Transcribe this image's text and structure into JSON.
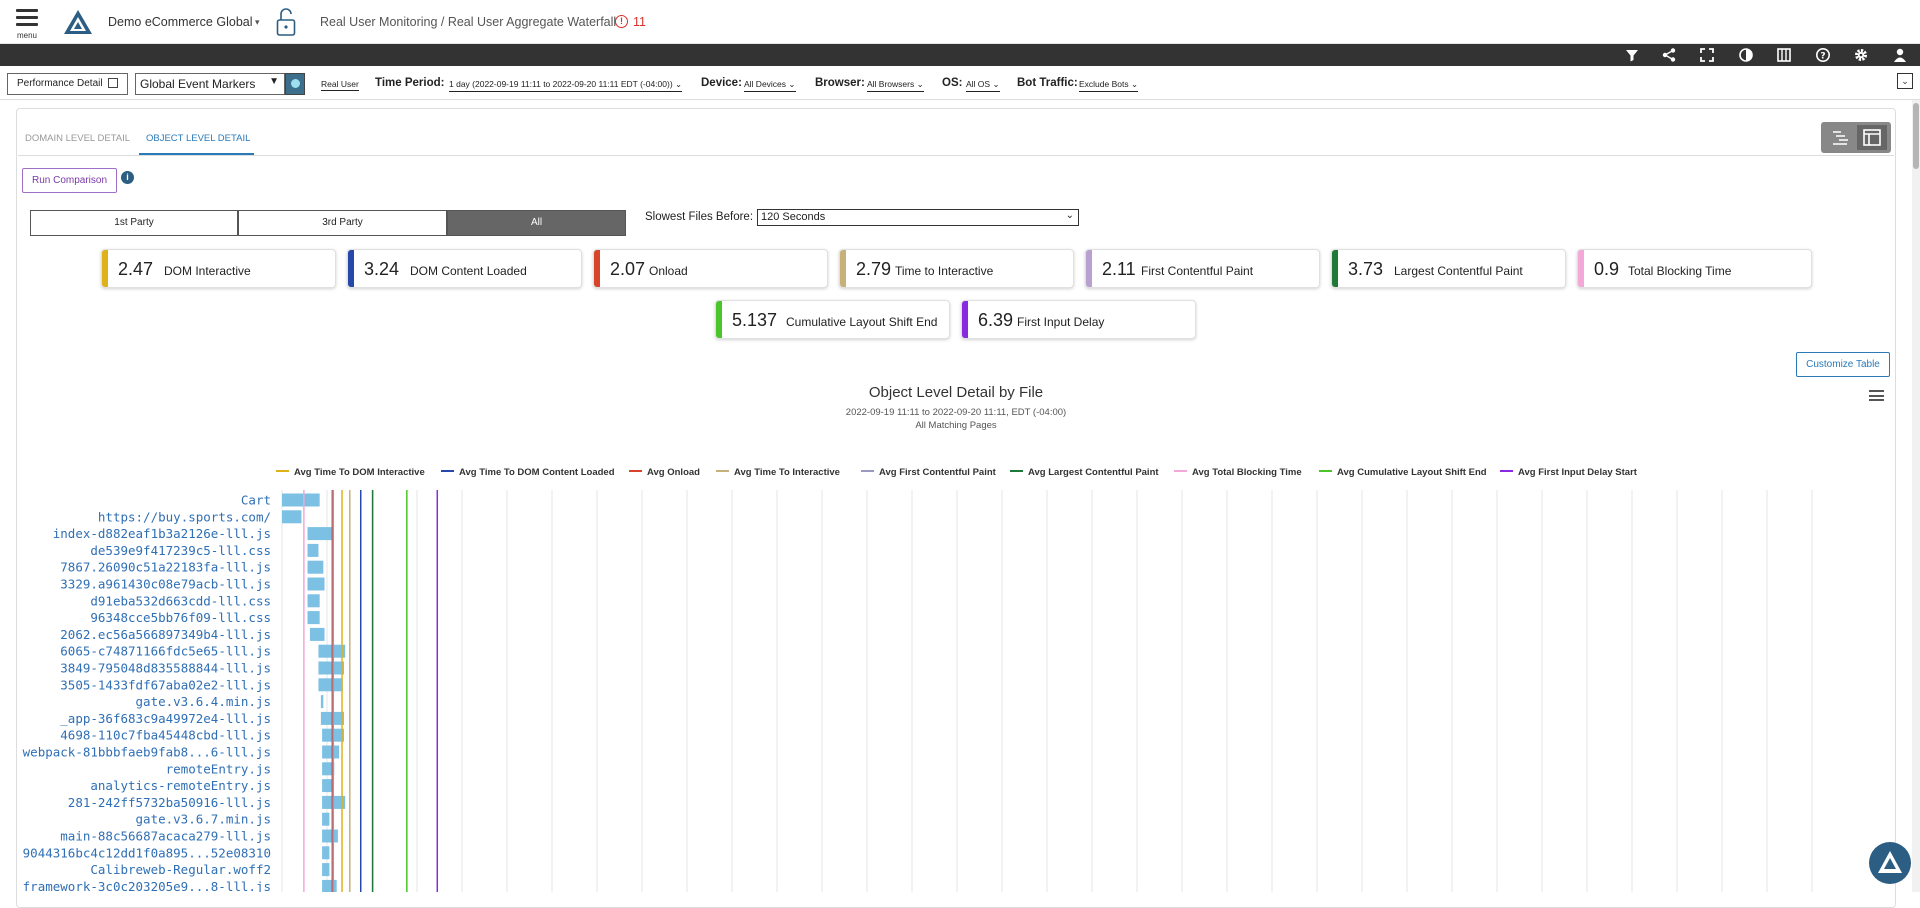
{
  "header": {
    "menu_label": "menu",
    "account": "Demo eCommerce Global",
    "breadcrumb": "Real User Monitoring / Real User Aggregate Waterfall",
    "alert_count": "11"
  },
  "toolbar": {
    "icons": [
      "filter-icon",
      "share-icon",
      "fullscreen-icon",
      "contrast-icon",
      "columns-icon",
      "help-icon",
      "settings-icon",
      "user-icon"
    ]
  },
  "filters": {
    "perf_detail_label": "Performance Detail",
    "event_markers": "Global Event Markers",
    "source": "Real User",
    "time_period_label": "Time Period:",
    "time_period_value": "1 day (2022-09-19 11:11 to 2022-09-20 11:11 EDT (-04:00))",
    "device_label": "Device:",
    "device_value": "All Devices",
    "browser_label": "Browser:",
    "browser_value": "All Browsers",
    "os_label": "OS:",
    "os_value": "All OS",
    "bot_label": "Bot Traffic:",
    "bot_value": "Exclude Bots"
  },
  "tabs": [
    {
      "label": "DOMAIN LEVEL DETAIL",
      "active": false
    },
    {
      "label": "OBJECT LEVEL DETAIL",
      "active": true
    }
  ],
  "run_comparison": "Run Comparison",
  "party": {
    "first": "1st Party",
    "third": "3rd Party",
    "all": "All",
    "selected": "All"
  },
  "slowest": {
    "label": "Slowest Files Before:",
    "value": "120 Seconds"
  },
  "metrics": [
    {
      "value": "2.47",
      "label": "DOM Interactive",
      "color": "#e0b21a"
    },
    {
      "value": "3.24",
      "label": "DOM Content Loaded",
      "color": "#2648a8"
    },
    {
      "value": "2.07",
      "label": "Onload",
      "color": "#d8442a"
    },
    {
      "value": "2.79",
      "label": "Time to Interactive",
      "color": "#c8b07a"
    },
    {
      "value": "2.11",
      "label": "First Contentful Paint",
      "color": "#b8a0d0"
    },
    {
      "value": "3.73",
      "label": "Largest Contentful Paint",
      "color": "#1f7a3a"
    },
    {
      "value": "0.9",
      "label": "Total Blocking Time",
      "color": "#f3a8d8"
    },
    {
      "value": "5.137",
      "label": "Cumulative Layout Shift End",
      "color": "#4ac62a"
    },
    {
      "value": "6.39",
      "label": "First Input Delay",
      "color": "#8a2ae0"
    }
  ],
  "customize_table": "Customize Table",
  "chart_data": {
    "type": "bar",
    "title": "Object Level Detail by File",
    "subtitle": "2022-09-19 11:11 to 2022-09-20 11:11, EDT (-04:00)",
    "scope": "All Matching Pages",
    "legend": [
      {
        "name": "Avg Time To DOM Interactive",
        "color": "#e0b21a"
      },
      {
        "name": "Avg Time To DOM Content Loaded",
        "color": "#2648a8"
      },
      {
        "name": "Avg Onload",
        "color": "#d8442a"
      },
      {
        "name": "Avg Time To Interactive",
        "color": "#c8b07a"
      },
      {
        "name": "Avg First Contentful Paint",
        "color": "#9a9ac0"
      },
      {
        "name": "Avg Largest Contentful Paint",
        "color": "#1f7a3a"
      },
      {
        "name": "Avg Total Blocking Time",
        "color": "#f3a8d8"
      },
      {
        "name": "Avg Cumulative Layout Shift End",
        "color": "#4ac62a"
      },
      {
        "name": "Avg First Input Delay Start",
        "color": "#8a2ae0"
      }
    ],
    "marker_values": [
      2.47,
      3.24,
      2.07,
      2.79,
      2.11,
      3.73,
      0.9,
      5.137,
      6.39
    ],
    "files": [
      {
        "name": "Cart",
        "start": 0.0,
        "end": 1.55
      },
      {
        "name": "https://buy.sports.com/",
        "start": 0.0,
        "end": 0.8
      },
      {
        "name": "index-d882eaf1b3a2126e-lll.js",
        "start": 1.05,
        "end": 2.1
      },
      {
        "name": "de539e9f417239c5-lll.css",
        "start": 1.05,
        "end": 1.5
      },
      {
        "name": "7867.26090c51a22183fa-lll.js",
        "start": 1.05,
        "end": 1.7
      },
      {
        "name": "3329.a961430c08e79acb-lll.js",
        "start": 1.05,
        "end": 1.75
      },
      {
        "name": "d91eba532d663cdd-lll.css",
        "start": 1.05,
        "end": 1.55
      },
      {
        "name": "96348cce5bb76f09-lll.css",
        "start": 1.05,
        "end": 1.55
      },
      {
        "name": "2062.ec56a566897349b4-lll.js",
        "start": 1.15,
        "end": 1.75
      },
      {
        "name": "6065-c74871166fdc5e65-lll.js",
        "start": 1.5,
        "end": 2.6
      },
      {
        "name": "3849-795048d835588844-lll.js",
        "start": 1.5,
        "end": 2.55
      },
      {
        "name": "3505-1433fdf67aba02e2-lll.js",
        "start": 1.5,
        "end": 2.5
      },
      {
        "name": "gate.v3.6.4.min.js",
        "start": 1.6,
        "end": 1.7
      },
      {
        "name": "_app-36f683c9a49972e4-lll.js",
        "start": 1.6,
        "end": 2.55
      },
      {
        "name": "4698-110c7fba45448cbd-lll.js",
        "start": 1.65,
        "end": 2.55
      },
      {
        "name": "webpack-81bbbfaeb9fab8...6-lll.js",
        "start": 1.65,
        "end": 2.35
      },
      {
        "name": "remoteEntry.js",
        "start": 1.65,
        "end": 2.15
      },
      {
        "name": "analytics-remoteEntry.js",
        "start": 1.65,
        "end": 2.1
      },
      {
        "name": "281-242ff5732ba50916-lll.js",
        "start": 1.65,
        "end": 2.6
      },
      {
        "name": "gate.v3.6.7.min.js",
        "start": 1.65,
        "end": 1.95
      },
      {
        "name": "main-88c56687acaca279-lll.js",
        "start": 1.65,
        "end": 2.3
      },
      {
        "name": "9044316bc4c12dd1f0a895...52e08310",
        "start": 1.65,
        "end": 1.95
      },
      {
        "name": "Calibreweb-Regular.woff2",
        "start": 1.65,
        "end": 1.95
      },
      {
        "name": "framework-3c0c203205e9...8-lll.js",
        "start": 1.65,
        "end": 2.25
      }
    ],
    "x_range": [
      0,
      65
    ],
    "grid": true
  }
}
